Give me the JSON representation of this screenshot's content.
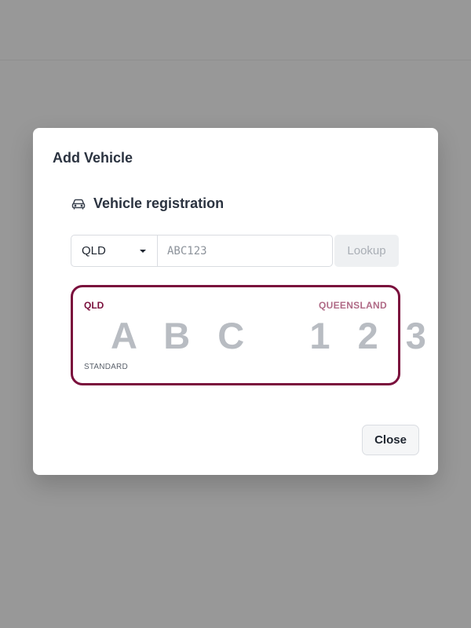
{
  "modal": {
    "title": "Add Vehicle",
    "section_title": "Vehicle registration",
    "section_icon": "car-icon"
  },
  "form": {
    "state_select": {
      "value": "QLD",
      "icon": "chevron-down-icon"
    },
    "plate_input": {
      "value": "",
      "placeholder": "ABC123"
    },
    "lookup_label": "Lookup"
  },
  "plate_preview": {
    "state": "QLD",
    "region": "QUEENSLAND",
    "number": "A B C   1 2 3",
    "type": "STANDARD"
  },
  "footer": {
    "close_label": "Close"
  },
  "colors": {
    "overlay": "#989898",
    "plate_border": "#7a0f3c",
    "plate_state_text": "#7a0f3c",
    "plate_region_text": "#b06a86",
    "plate_number_text": "#b8bcc2",
    "lookup_disabled_bg": "#eef0f2"
  }
}
